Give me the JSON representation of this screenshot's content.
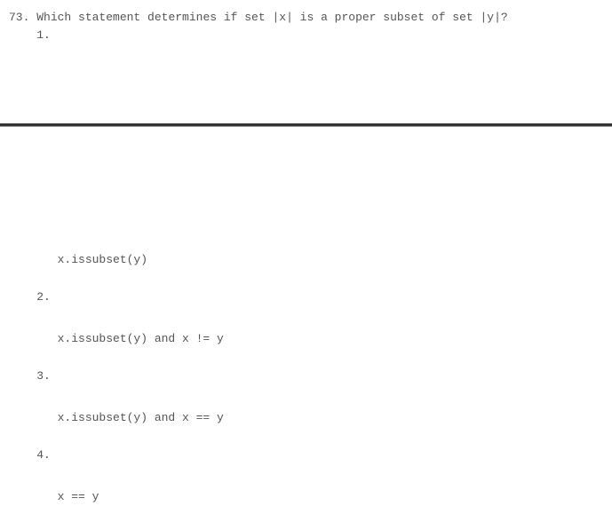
{
  "question": {
    "number": "73.",
    "text": "Which statement determines if set |x| is a proper subset of set |y|?"
  },
  "options": {
    "n1": "1.",
    "n2": "2.",
    "n3": "3.",
    "n4": "4.",
    "code1": "x.issubset(y)",
    "code2": "x.issubset(y) and x != y",
    "code3": "x.issubset(y) and x == y",
    "code4": "x == y"
  }
}
